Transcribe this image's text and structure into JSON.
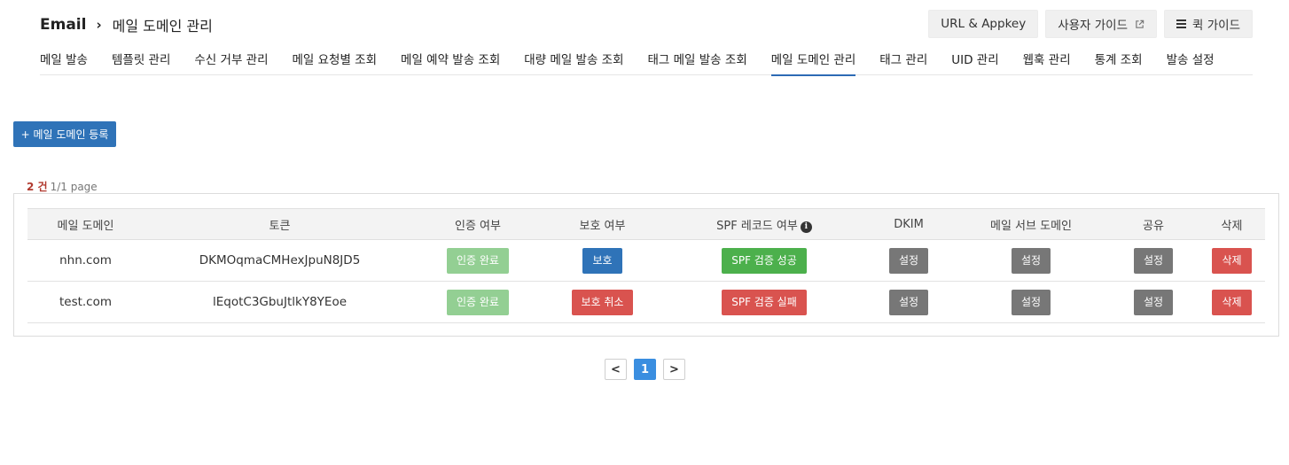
{
  "breadcrumb": {
    "root": "Email",
    "separator": "›",
    "page": "메일 도메인 관리"
  },
  "top_buttons": [
    {
      "label": "URL & Appkey"
    },
    {
      "label": "사용자 가이드"
    },
    {
      "label": "퀵 가이드"
    }
  ],
  "tabs": [
    "메일 발송",
    "템플릿 관리",
    "수신 거부 관리",
    "메일 요청별 조회",
    "메일 예약 발송 조회",
    "대량 메일 발송 조회",
    "태그 메일 발송 조회",
    "메일 도메인 관리",
    "태그 관리",
    "UID 관리",
    "웹훅 관리",
    "통계 조회",
    "발송 설정"
  ],
  "active_tab": "메일 도메인 관리",
  "add_button": {
    "label": "+ 메일 도메인 등록"
  },
  "count": {
    "number": "2 건",
    "page_info": "1/1 page"
  },
  "table": {
    "headers": {
      "domain": "메일 도메인",
      "token": "토큰",
      "auth": "인증 여부",
      "protect": "보호 여부",
      "spf": "SPF 레코드 여부",
      "dkim": "DKIM",
      "subdomain": "메일 서브 도메인",
      "share": "공유",
      "delete": "삭제"
    },
    "rows": [
      {
        "domain": "nhn.com",
        "token": "DKMOqmaCMHexJpuN8JD5",
        "auth": "인증 완료",
        "protect": "보호",
        "spf": "SPF 검증 성공",
        "dkim": "설정",
        "subdomain": "설정",
        "share": "설정",
        "delete": "삭제"
      },
      {
        "domain": "test.com",
        "token": "lEqotC3GbuJtlkY8YEoe",
        "auth": "인증 완료",
        "protect": "보호 취소",
        "spf": "SPF 검증 실패",
        "dkim": "설정",
        "subdomain": "설정",
        "share": "설정",
        "delete": "삭제"
      }
    ]
  },
  "pager": {
    "prev": "<",
    "current": "1",
    "next": ">"
  },
  "colors": {
    "primary": "#2f73b8",
    "success": "#4cb04c",
    "success_light": "#93cf93",
    "danger": "#d9534f",
    "neutral": "#777777",
    "count_accent": "#b13a2f",
    "pager_active": "#3a8ee0"
  },
  "icons": [
    "external-link-icon",
    "hamburger-menu-icon",
    "info-icon",
    "chevron-right-icon"
  ]
}
